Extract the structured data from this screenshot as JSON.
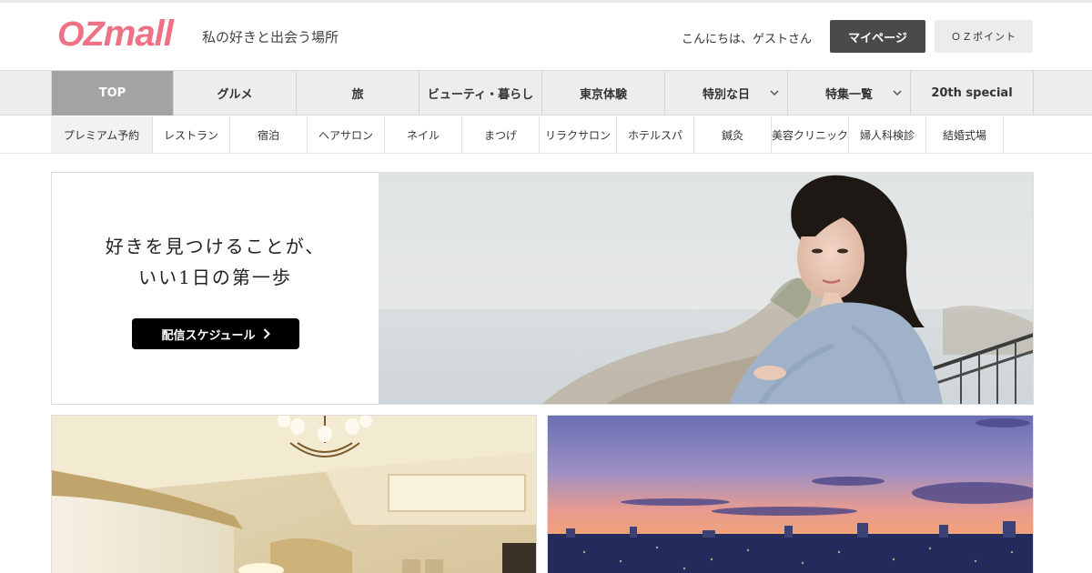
{
  "header": {
    "logo_oz": "OZ",
    "logo_mall": "mall",
    "tagline": "私の好きと出会う場所",
    "greeting": "こんにちは、ゲストさん",
    "mypage_label": "マイページ",
    "ozpoint_label": "ＯＺポイント"
  },
  "main_nav": [
    {
      "label": "TOP",
      "active": true
    },
    {
      "label": "グルメ"
    },
    {
      "label": "旅"
    },
    {
      "label": "ビューティ・暮らし"
    },
    {
      "label": "東京体験"
    },
    {
      "label": "特別な日",
      "icon": "chevron-down-icon"
    },
    {
      "label": "特集一覧",
      "icon": "chevron-down-icon"
    },
    {
      "label": "20th special"
    }
  ],
  "sub_nav": [
    {
      "label": "プレミアム予約"
    },
    {
      "label": "レストラン"
    },
    {
      "label": "宿泊"
    },
    {
      "label": "ヘアサロン"
    },
    {
      "label": "ネイル"
    },
    {
      "label": "まつげ"
    },
    {
      "label": "リラクサロン"
    },
    {
      "label": "ホテルスパ"
    },
    {
      "label": "鍼灸"
    },
    {
      "label": "美容クリニック"
    },
    {
      "label": "婦人科検診"
    },
    {
      "label": "結婚式場"
    }
  ],
  "hero": {
    "line1": "好きを見つけることが、",
    "line2": "いい1日の第一歩",
    "button_label": "配信スケジュール",
    "button_icon": "chevron-right-icon"
  },
  "colors": {
    "brand_pink": "#ef7185",
    "active_tab": "#a3a3a3",
    "mypage_bg": "#4a4a4a"
  }
}
